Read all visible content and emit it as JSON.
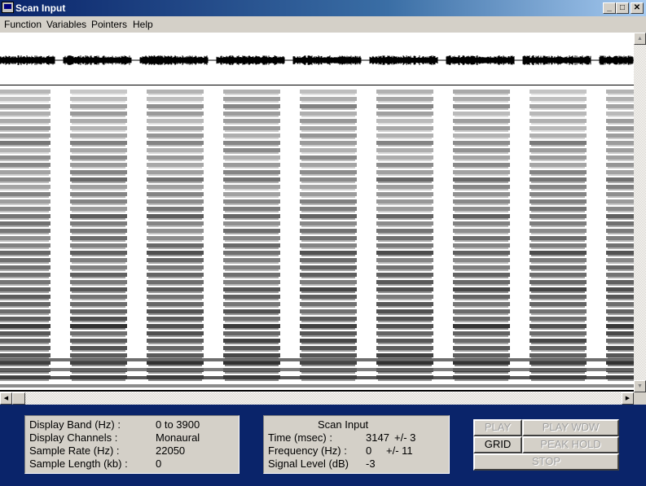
{
  "window": {
    "title": "Scan Input",
    "controls": {
      "minimize": "_",
      "maximize": "□",
      "close": "✕"
    }
  },
  "menu": [
    {
      "label": "Function"
    },
    {
      "label": "Variables"
    },
    {
      "label": "Pointers"
    },
    {
      "label": "Help"
    }
  ],
  "spectrogram": {
    "segments": 9,
    "waveform_color": "#000000",
    "background": "#ffffff"
  },
  "scrollbars": {
    "vertical": {
      "up": "▲",
      "down": "▼"
    },
    "horizontal": {
      "left": "◀",
      "right": "▶"
    }
  },
  "display_info": {
    "rows": [
      {
        "label": "Display Band (Hz) :",
        "value": "0 to 3900"
      },
      {
        "label": "Display Channels :",
        "value": "Monaural"
      },
      {
        "label": "Sample Rate (Hz) :",
        "value": "22050"
      },
      {
        "label": "Sample Length (kb) :",
        "value": "0"
      }
    ]
  },
  "scan_info": {
    "title": "Scan Input",
    "rows": [
      {
        "label": "Time (msec) :",
        "value": "3147",
        "tolerance": "+/- 3"
      },
      {
        "label": "Frequency (Hz) :",
        "value": "0",
        "tolerance": "+/- 11"
      },
      {
        "label": "Signal Level (dB)",
        "value": "-3",
        "tolerance": ""
      }
    ]
  },
  "buttons": {
    "play": {
      "label": "PLAY",
      "enabled": false
    },
    "play_wdw": {
      "label": "PLAY WDW",
      "enabled": false
    },
    "grid": {
      "label": "GRID",
      "enabled": true
    },
    "peak_hold": {
      "label": "PEAK HOLD",
      "enabled": false
    },
    "stop": {
      "label": "STOP",
      "enabled": false
    }
  },
  "colors": {
    "panel_bg": "#0a246a",
    "title_gradient_start": "#0a246a",
    "title_gradient_end": "#a6caf0"
  }
}
